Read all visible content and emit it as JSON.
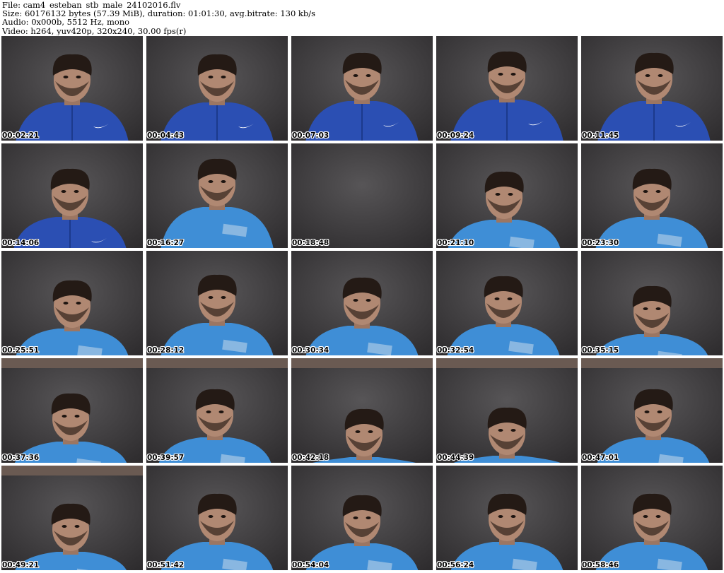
{
  "header": {
    "file_line": "File: cam4_esteban_stb_male_24102016.flv",
    "size_line": "Size: 60176132 bytes (57.39 MiB), duration: 01:01:30, avg.bitrate: 130 kb/s",
    "audio_line": "Audio: 0x000b, 5512 Hz, mono",
    "video_line": "Video: h264, yuv420p, 320x240, 30.00 fps(r)"
  },
  "colors": {
    "wall": "#3f3d3f",
    "jacket": "#2b4fb3",
    "tshirt": "#3f8ed6",
    "skin": "#b08872",
    "hair": "#241a15"
  },
  "thumbnails": [
    {
      "time": "00:02:21",
      "shirt": "jacket"
    },
    {
      "time": "00:04:43",
      "shirt": "jacket"
    },
    {
      "time": "00:07:03",
      "shirt": "jacket"
    },
    {
      "time": "00:09:24",
      "shirt": "jacket"
    },
    {
      "time": "00:11:45",
      "shirt": "jacket"
    },
    {
      "time": "00:14:06",
      "shirt": "jacket"
    },
    {
      "time": "00:16:27",
      "shirt": "tshirt"
    },
    {
      "time": "00:18:48",
      "shirt": "none"
    },
    {
      "time": "00:21:10",
      "shirt": "tshirt"
    },
    {
      "time": "00:23:30",
      "shirt": "tshirt"
    },
    {
      "time": "00:25:51",
      "shirt": "tshirt"
    },
    {
      "time": "00:28:12",
      "shirt": "tshirt"
    },
    {
      "time": "00:30:34",
      "shirt": "tshirt"
    },
    {
      "time": "00:32:54",
      "shirt": "tshirt"
    },
    {
      "time": "00:35:15",
      "shirt": "tshirt"
    },
    {
      "time": "00:37:36",
      "shirt": "tshirt"
    },
    {
      "time": "00:39:57",
      "shirt": "tshirt"
    },
    {
      "time": "00:42:18",
      "shirt": "tshirt"
    },
    {
      "time": "00:44:39",
      "shirt": "tshirt"
    },
    {
      "time": "00:47:01",
      "shirt": "tshirt"
    },
    {
      "time": "00:49:21",
      "shirt": "tshirt"
    },
    {
      "time": "00:51:42",
      "shirt": "tshirt"
    },
    {
      "time": "00:54:04",
      "shirt": "tshirt"
    },
    {
      "time": "00:56:24",
      "shirt": "tshirt"
    },
    {
      "time": "00:58:46",
      "shirt": "tshirt"
    }
  ]
}
